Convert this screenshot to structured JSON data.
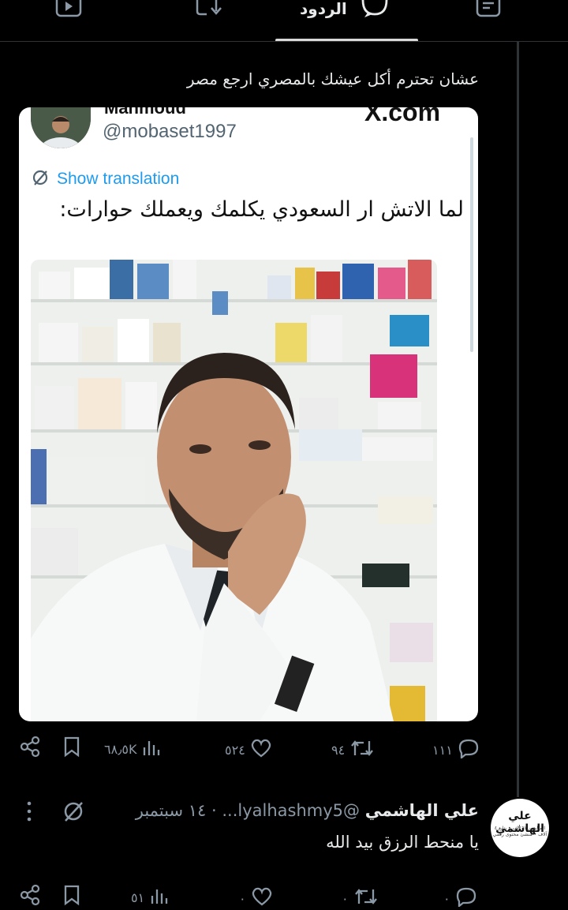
{
  "top_tabs": {
    "active_label": "الردود",
    "icons": [
      "video-icon",
      "retweet-icon",
      "comment-icon",
      "article-icon"
    ]
  },
  "post": {
    "text": "عشان تحترم أكل عيشك بالمصري ارجع مصر",
    "quoted_card": {
      "author_name": "Mahmoud",
      "handle": "@mobaset1997",
      "brand": "X.com",
      "translate_label": "Show translation",
      "tweet_text": "لما الاتش ار السعودي يكلمك ويعملك حوارات:"
    },
    "actions": {
      "replies": "١١١",
      "reposts": "٩٤",
      "likes": "٥٢٤",
      "views": "٦٨٫٥K"
    }
  },
  "reply": {
    "avatar_text": "علي الهاشمي",
    "avatar_subtext": "المتابعين ٦١ ألف • يتابع ٤ آلاف • منشئ محتوى رقمي",
    "author_name": "علي الهاشمي",
    "meta": "@lyalhashmy5... · ١٤ سبتمبر",
    "text": "يا منحط الرزق بيد الله",
    "actions": {
      "replies": "٠",
      "reposts": "٠",
      "likes": "٠",
      "views": "٥١"
    }
  },
  "colors": {
    "background": "#000000",
    "text": "#e7e9ea",
    "muted": "#8b98a5",
    "link_blue": "#1d9bf0"
  }
}
